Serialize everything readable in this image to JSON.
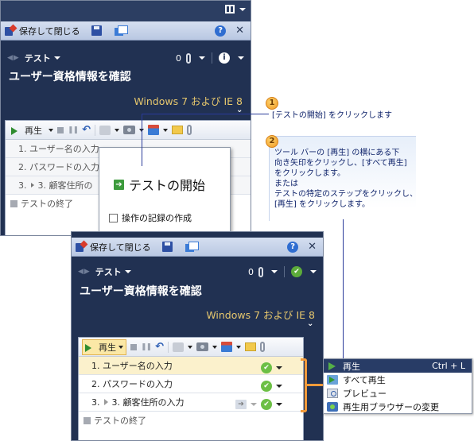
{
  "runner": {
    "save_close_label": "保存して閉じる",
    "nav_test_label": "テスト",
    "attachment_count": "0",
    "test_title": "ユーザー資格情報を確認",
    "configuration": "Windows 7 および IE 8"
  },
  "window1": {
    "toolbar_play_label": "再生",
    "steps": [
      {
        "label": "1. ユーザー名の入力"
      },
      {
        "label": "2. パスワードの入力"
      },
      {
        "label": "3. 顧客住所の"
      }
    ],
    "end_label": "テストの終了"
  },
  "popup": {
    "start_test_label": "テストの開始",
    "record_action_label": "操作の記録の作成"
  },
  "window2": {
    "toolbar_play_label": "再生",
    "steps": [
      {
        "label": "1. ユーザー名の入力"
      },
      {
        "label": "2. パスワードの入力"
      },
      {
        "label": "3. 顧客住所の入力"
      }
    ],
    "end_label": "テストの終了"
  },
  "callouts": [
    {
      "number": "1",
      "text": "[テストの開始] をクリックします"
    },
    {
      "number": "2",
      "lines": [
        "ツール バーの [再生] の横にある下",
        "向き矢印をクリックし、[すべて再生]",
        "をクリックします。",
        "または",
        "テストの特定のステップをクリックし、",
        "[再生] をクリックします。"
      ]
    }
  ],
  "play_menu": {
    "items": [
      {
        "label": "再生",
        "shortcut": "Ctrl + L",
        "icon": "play-icon"
      },
      {
        "label": "すべて再生",
        "icon": "play-all-icon"
      },
      {
        "label": "プレビュー",
        "icon": "preview-icon"
      },
      {
        "label": "再生用ブラウザーの変更",
        "icon": "browser-icon"
      }
    ]
  },
  "colors": {
    "window_bg": "#213152",
    "accent_orange": "#f29a3a",
    "callout_line": "#2a3b9a",
    "config_text": "#e6c76d"
  }
}
